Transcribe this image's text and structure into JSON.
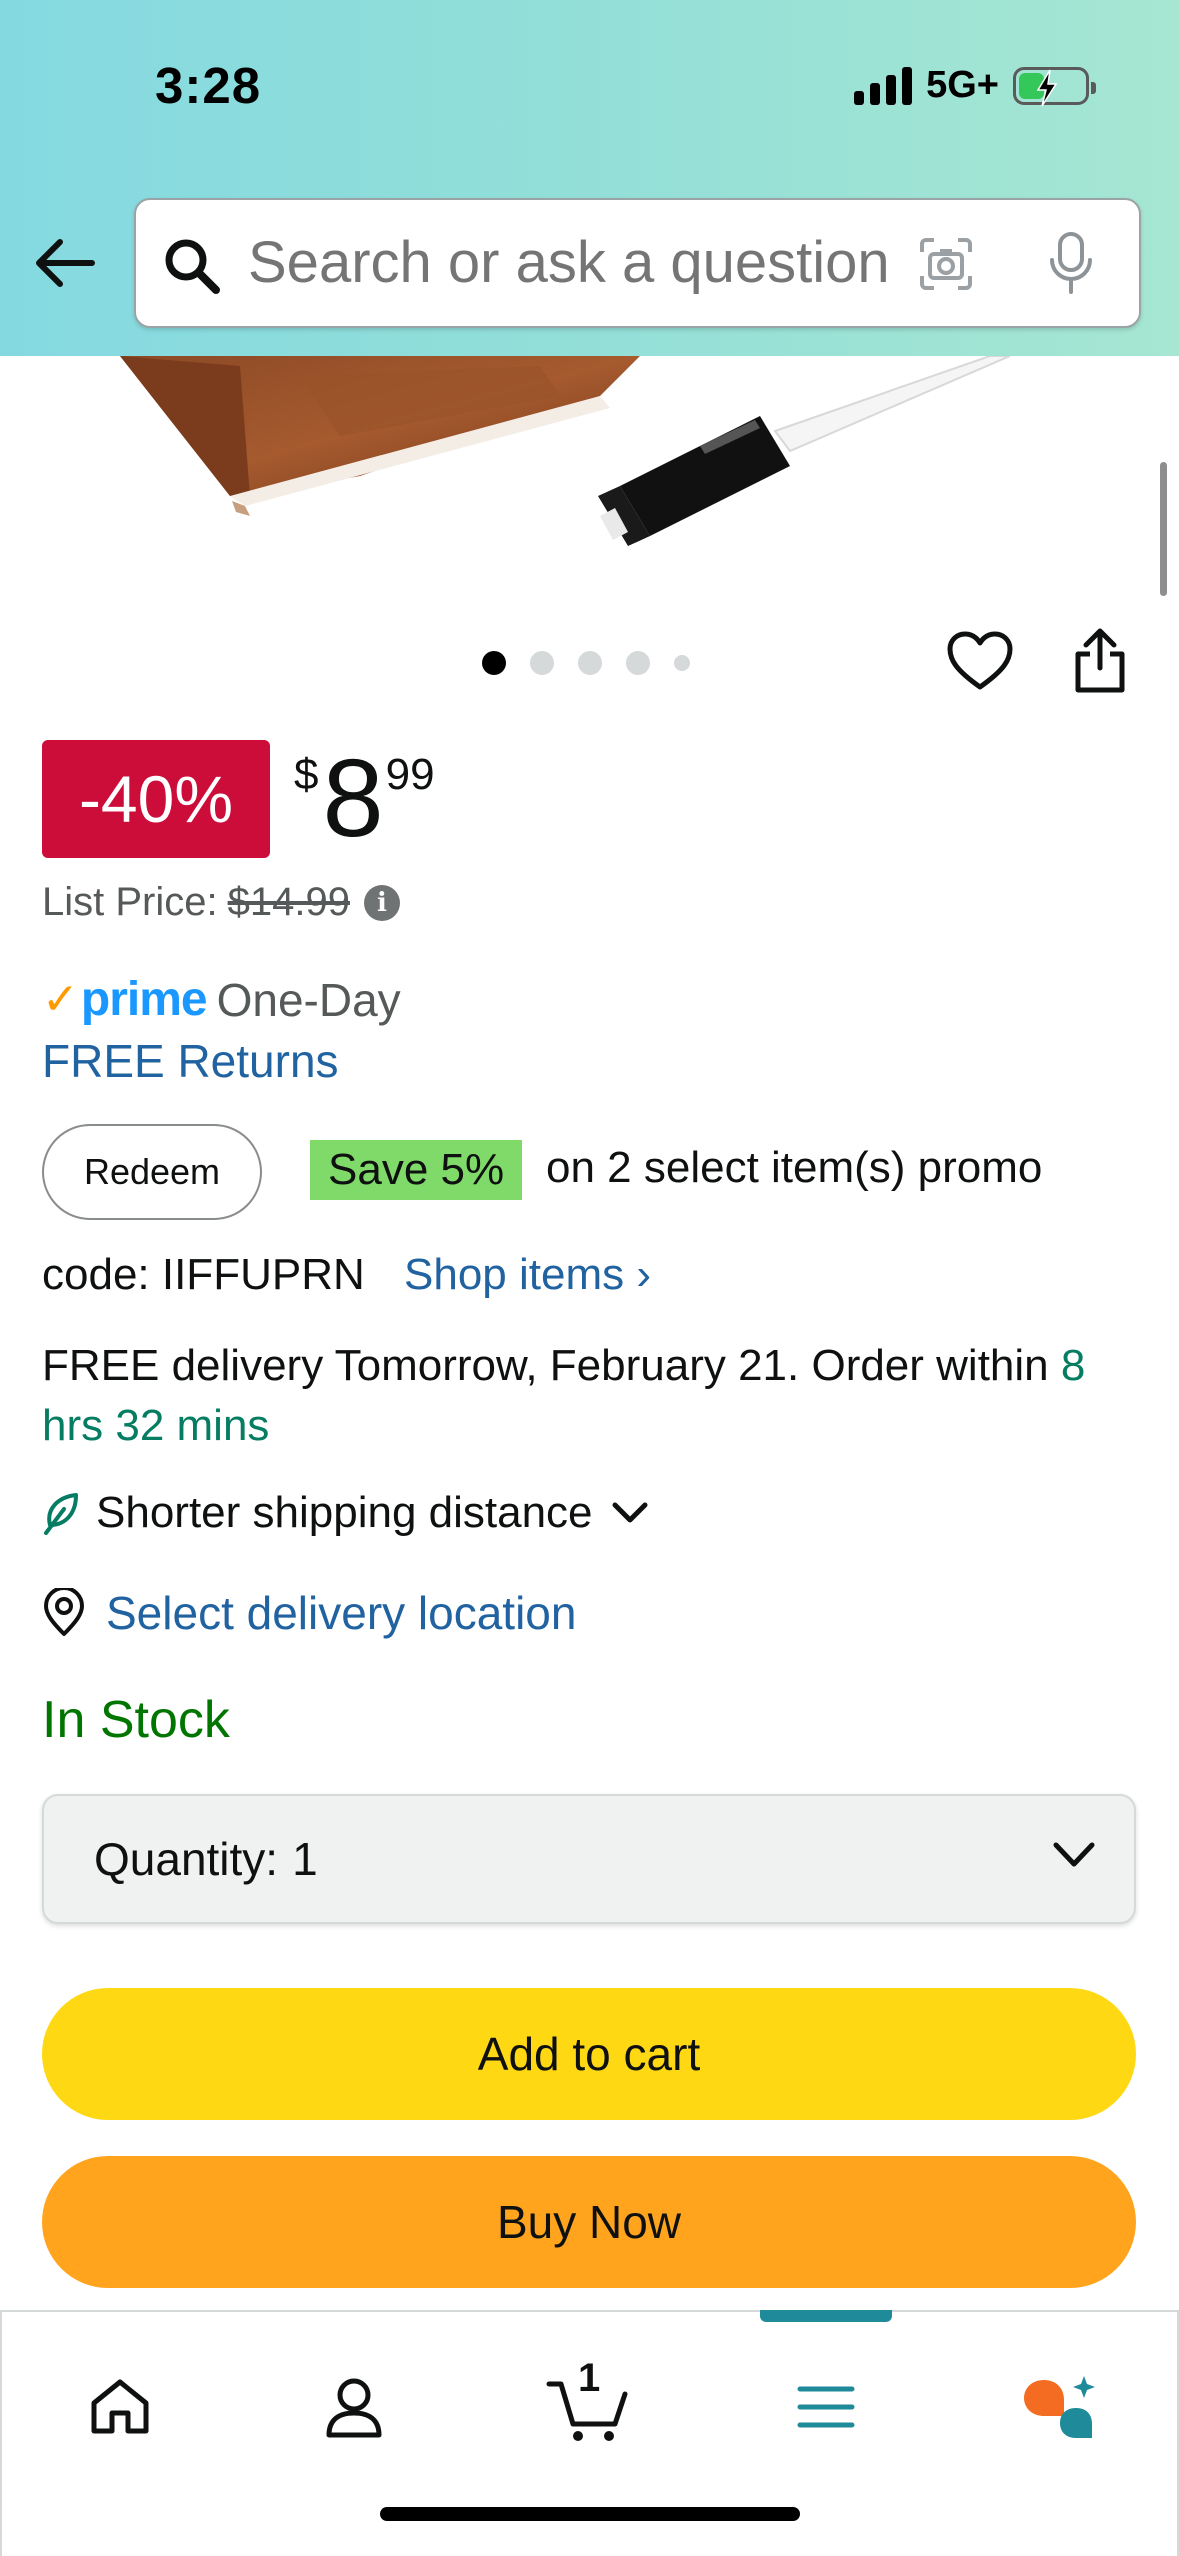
{
  "status_bar": {
    "time": "3:28",
    "network": "5G+"
  },
  "search": {
    "placeholder": "Search or ask a question"
  },
  "gallery": {
    "image_count": 5,
    "active_index": 0
  },
  "price": {
    "discount": "-40%",
    "symbol": "$",
    "whole": "8",
    "fraction": "99",
    "list_price_label": "List Price:",
    "list_price": "$14.99"
  },
  "prime": {
    "logo": "prime",
    "label": "One-Day"
  },
  "free_returns": "FREE Returns",
  "promo": {
    "redeem_label": "Redeem",
    "save_label": "Save 5%",
    "text": "on 2 select item(s) promo",
    "code": "code: IIFFUPRN",
    "shop_items": "Shop items ›"
  },
  "delivery": {
    "text": "FREE delivery Tomorrow, February 21. Order within",
    "time": "8 hrs 32 mins"
  },
  "shipping": {
    "label": "Shorter shipping distance"
  },
  "location": {
    "label": "Select delivery location"
  },
  "stock": "In Stock",
  "quantity": {
    "label": "Quantity:",
    "value": "1"
  },
  "actions": {
    "add_to_cart": "Add to cart",
    "buy_now": "Buy Now"
  },
  "bottom_nav": {
    "items": [
      "home-icon",
      "account-icon",
      "cart-icon",
      "menu-icon",
      "rufus-icon"
    ],
    "cart_count": "1",
    "active": "menu"
  },
  "colors": {
    "header_gradient": [
      "#84d9e1",
      "#a6e6d2"
    ],
    "discount": "#cc0c39",
    "link": "#2162a1",
    "in_stock": "#007600",
    "add_to_cart": "#ffd814",
    "buy_now": "#ffa41c",
    "save_badge": "#7fda69"
  }
}
